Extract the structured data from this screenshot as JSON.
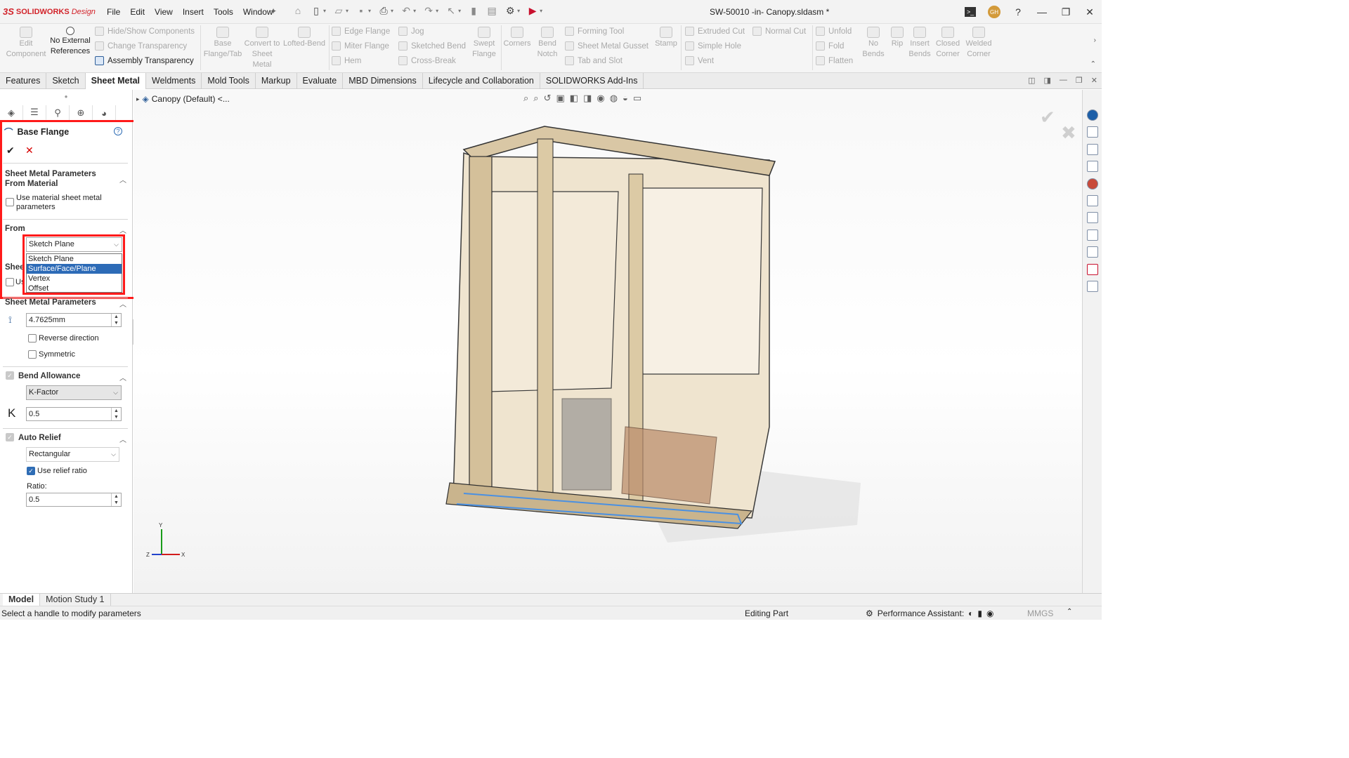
{
  "app": {
    "logo_ds": "3S",
    "logo_brand": "SOLIDWORKS",
    "logo_edition": "Design",
    "document_title": "SW-50010 -in- Canopy.sldasm *"
  },
  "menu": [
    "File",
    "Edit",
    "View",
    "Insert",
    "Tools",
    "Window"
  ],
  "user": {
    "initials": "GH"
  },
  "ribbon": {
    "edit_component": "Edit Component",
    "no_external": "No External References",
    "hide_show": "Hide/Show Components",
    "change_transparency": "Change Transparency",
    "assembly_transparency": "Assembly Transparency",
    "base_flange": "Base Flange/Tab",
    "convert": "Convert to Sheet Metal",
    "lofted_bend": "Lofted-Bend",
    "edge_flange": "Edge Flange",
    "miter_flange": "Miter Flange",
    "hem": "Hem",
    "jog": "Jog",
    "sketched_bend": "Sketched Bend",
    "cross_break": "Cross-Break",
    "swept_flange": "Swept Flange",
    "corners": "Corners",
    "bend_notch": "Bend Notch",
    "forming_tool": "Forming Tool",
    "gusset": "Sheet Metal Gusset",
    "tab_slot": "Tab and Slot",
    "stamp": "Stamp",
    "extruded_cut": "Extruded Cut",
    "simple_hole": "Simple Hole",
    "vent": "Vent",
    "normal_cut": "Normal Cut",
    "unfold": "Unfold",
    "fold": "Fold",
    "flatten": "Flatten",
    "no_bends": "No Bends",
    "rip": "Rip",
    "insert_bends": "Insert Bends",
    "closed_corner": "Closed Corner",
    "welded_corner": "Welded Corner"
  },
  "tabs": [
    "Features",
    "Sketch",
    "Sheet Metal",
    "Weldments",
    "Mold Tools",
    "Markup",
    "Evaluate",
    "MBD Dimensions",
    "Lifecycle and Collaboration",
    "SOLIDWORKS Add-Ins"
  ],
  "active_tab": "Sheet Metal",
  "property_manager": {
    "title": "Base Flange",
    "section_material": "Sheet Metal Parameters From Material",
    "use_material": "Use material sheet metal parameters",
    "from_label": "From",
    "from_value": "Sketch Plane",
    "from_options": [
      "Sketch Plane",
      "Surface/Face/Plane",
      "Vertex",
      "Offset"
    ],
    "highlighted_option": "Surface/Face/Plane",
    "hidden_section_fragment": "Shee",
    "hidden_checkbox_fragment": "Us",
    "section_params": "Sheet Metal Parameters",
    "thickness": "4.7625mm",
    "reverse_direction": "Reverse direction",
    "symmetric": "Symmetric",
    "section_bend": "Bend Allowance",
    "bend_type": "K-Factor",
    "k_label": "K",
    "k_value": "0.5",
    "section_relief": "Auto Relief",
    "relief_type": "Rectangular",
    "use_relief_ratio": "Use relief ratio",
    "ratio_label": "Ratio:",
    "ratio_value": "0.5"
  },
  "viewport": {
    "tree_root": "Canopy (Default) <...",
    "axis_y": "Y",
    "axis_x": "X",
    "axis_z": "Z"
  },
  "bottom_tabs": [
    "Model",
    "Motion Study 1"
  ],
  "status": {
    "hint": "Select a handle to modify parameters",
    "mode": "Editing Part",
    "performance": "Performance Assistant:",
    "units": "MMGS"
  }
}
